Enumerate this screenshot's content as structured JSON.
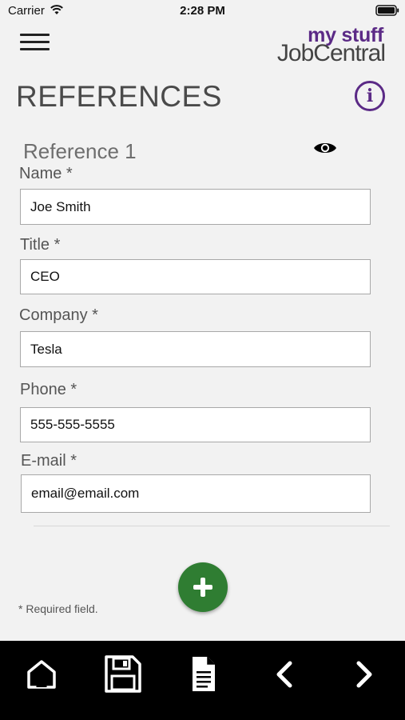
{
  "status_bar": {
    "carrier": "Carrier",
    "time": "2:28 PM"
  },
  "header": {
    "menu_icon": "hamburger-menu-icon",
    "logo_top": "my stuff",
    "logo_bottom": "JobCentral",
    "logo_top_color": "#5b2a86"
  },
  "page": {
    "title": "REFERENCES",
    "info_icon": "info-icon",
    "accent_color": "#5b2a86"
  },
  "reference": {
    "heading": "Reference 1",
    "visibility_icon": "eye-icon",
    "fields": {
      "name": {
        "label": "Name *",
        "value": "Joe Smith"
      },
      "title": {
        "label": "Title *",
        "value": "CEO"
      },
      "company": {
        "label": "Company *",
        "value": "Tesla"
      },
      "phone": {
        "label": "Phone *",
        "value": "555-555-5555"
      },
      "email": {
        "label": "E-mail *",
        "value": "email@email.com"
      }
    }
  },
  "add_button": {
    "icon": "plus-icon",
    "color": "#2f7d32"
  },
  "required_note": "* Required field.",
  "toolbar": {
    "items": [
      "home-icon",
      "save-icon",
      "document-icon",
      "chevron-left-icon",
      "chevron-right-icon"
    ],
    "background": "#000000"
  }
}
